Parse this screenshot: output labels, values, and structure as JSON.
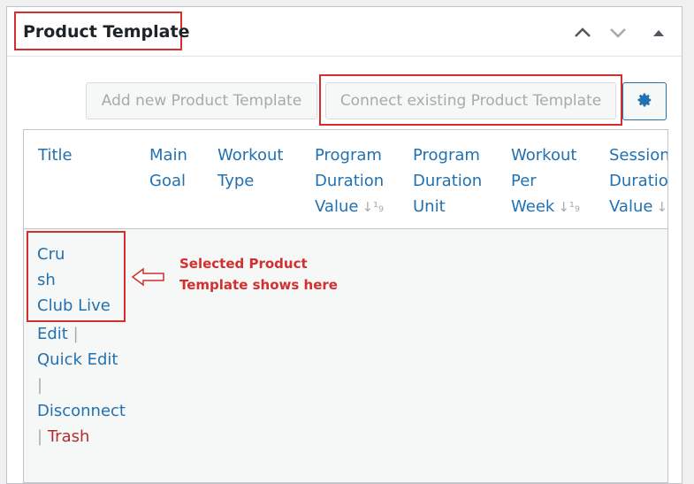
{
  "panel": {
    "title": "Product Template",
    "controls": [
      "chevron-up-icon",
      "chevron-down-icon",
      "triangle-up-icon"
    ]
  },
  "toolbar": {
    "add_label": "Add new Product Template",
    "connect_label": "Connect existing Product Template",
    "gear_icon": "gear-icon"
  },
  "table": {
    "columns": [
      {
        "lines": [
          "Title"
        ],
        "sortable": false
      },
      {
        "lines": [
          "Main",
          "Goal"
        ],
        "sortable": false
      },
      {
        "lines": [
          "Workout",
          "Type"
        ],
        "sortable": false
      },
      {
        "lines": [
          "Program",
          "Duration",
          "Value"
        ],
        "sortable": true
      },
      {
        "lines": [
          "Program",
          "Duration",
          "Unit"
        ],
        "sortable": false
      },
      {
        "lines": [
          "Workout",
          "Per",
          "Week"
        ],
        "sortable": true
      },
      {
        "lines": [
          "Session",
          "Duration",
          "Value"
        ],
        "sortable": true
      }
    ],
    "row": {
      "title_lines": [
        "Cru",
        "sh",
        "Club Live"
      ],
      "actions": {
        "edit": "Edit",
        "quick_edit": "Quick Edit",
        "disconnect": "Disconnect",
        "trash": "Trash",
        "separator": "|"
      }
    }
  },
  "annotation": {
    "line1": "Selected Product",
    "line2": "Template shows here"
  },
  "colors": {
    "link": "#2271b1",
    "trash": "#b32d2e",
    "annotation": "#d32f2f"
  }
}
